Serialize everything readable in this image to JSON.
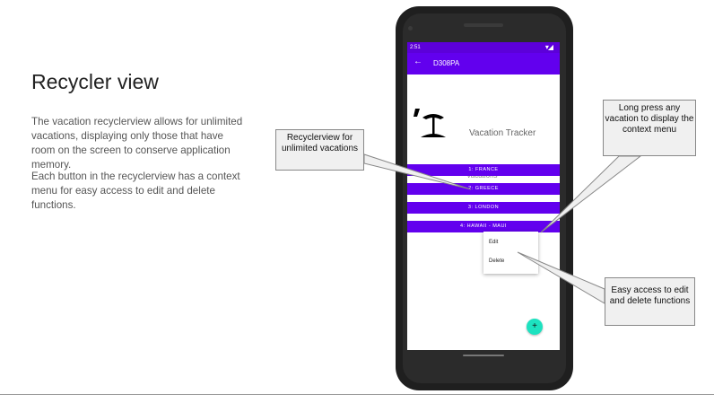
{
  "slide": {
    "title": "Recycler view",
    "paragraph1": "The vacation recyclerview allows for unlimited vacations, displaying only those that have room on the screen to conserve application memory.",
    "paragraph2": "Each button in the recyclerview has a context menu for easy access to edit and delete functions."
  },
  "app": {
    "status_time": "2:51",
    "toolbar_title": "D308PA",
    "app_name": "Vacation Tracker",
    "vacations_label": "Vacations",
    "vacations": [
      "1: FRANCE",
      "2: GREECE",
      "3: LONDON",
      "4: HAWAII - MAUI"
    ],
    "context_menu": [
      "Edit",
      "Delete"
    ],
    "fab_label": "+"
  },
  "callouts": {
    "recyclerview": "Recyclerview for unlimited vacations",
    "long_press": "Long press any vacation to display the context menu",
    "easy_access": "Easy access to edit and delete functions"
  },
  "colors": {
    "primary": "#6200ee",
    "status_bar": "#5c00d9",
    "fab": "#1de2c0"
  },
  "icons": {
    "back": "arrow-left-icon",
    "logo": "beach-umbrella-icon",
    "fab": "plus-icon"
  }
}
